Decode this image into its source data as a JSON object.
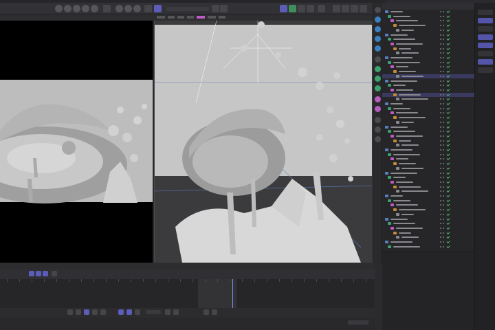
{
  "app": {
    "accent": "#5b5db8",
    "viewport_overlay_color": "#c05ac6",
    "selection_color": "#3a3a60",
    "check_color": "#4fc36a"
  },
  "toolbar": {
    "icons": [
      "move-icon",
      "rotate-icon",
      "scale-icon",
      "render-icon",
      "render-settings-icon",
      "close-icon",
      "grid-icon",
      "layout-icon",
      "snap-icon",
      "viewport-icon"
    ]
  },
  "object_manager": {
    "row_count": 52,
    "selected_rows": [
      14,
      18
    ]
  },
  "timeline": {
    "playhead_percent": 62
  },
  "viewports": {
    "left_label": "",
    "right_label": ""
  }
}
